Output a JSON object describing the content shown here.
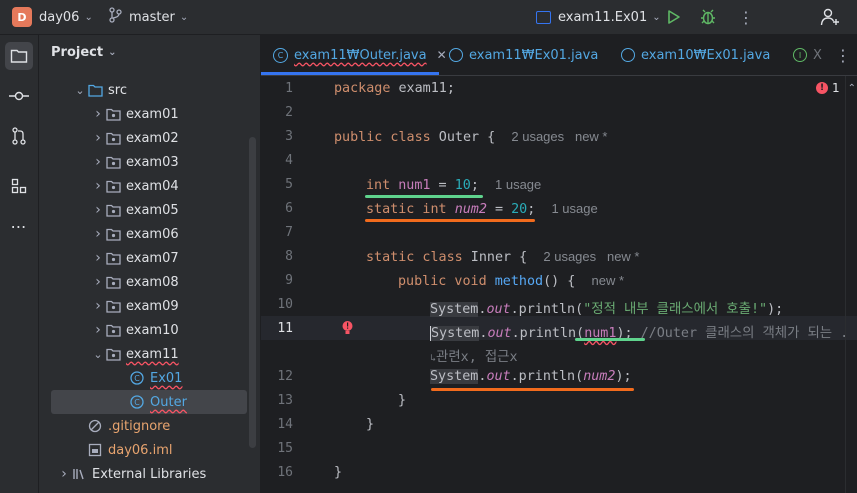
{
  "titlebar": {
    "project_badge": "D",
    "project_name": "day06",
    "branch": "master",
    "run_config": "exam11.Ex01"
  },
  "sidebar_icons": [
    "folder-icon",
    "commit-icon",
    "pull-requests-icon",
    "structure-icon",
    "more-icon"
  ],
  "project_panel": {
    "title": "Project",
    "tree": [
      {
        "label": "src",
        "type": "folder",
        "indent": 1,
        "expanded": true
      },
      {
        "label": "exam01",
        "type": "package",
        "indent": 2
      },
      {
        "label": "exam02",
        "type": "package",
        "indent": 2
      },
      {
        "label": "exam03",
        "type": "package",
        "indent": 2
      },
      {
        "label": "exam04",
        "type": "package",
        "indent": 2
      },
      {
        "label": "exam05",
        "type": "package",
        "indent": 2
      },
      {
        "label": "exam06",
        "type": "package",
        "indent": 2
      },
      {
        "label": "exam07",
        "type": "package",
        "indent": 2
      },
      {
        "label": "exam08",
        "type": "package",
        "indent": 2
      },
      {
        "label": "exam09",
        "type": "package",
        "indent": 2
      },
      {
        "label": "exam10",
        "type": "package",
        "indent": 2
      },
      {
        "label": "exam11",
        "type": "package",
        "indent": 2,
        "expanded": true
      },
      {
        "label": "Ex01",
        "type": "class",
        "indent": 3
      },
      {
        "label": "Outer",
        "type": "class",
        "indent": 3,
        "selected": true
      },
      {
        "label": ".gitignore",
        "type": "ignore",
        "indent": 1
      },
      {
        "label": "day06.iml",
        "type": "iml",
        "indent": 1
      },
      {
        "label": "External Libraries",
        "type": "lib",
        "indent": 0
      }
    ]
  },
  "tabs": [
    {
      "label": "exam11₩Outer.java",
      "active": true
    },
    {
      "label": "exam11₩Ex01.java",
      "active": false
    },
    {
      "label": "exam10₩Ex01.java",
      "active": false
    },
    {
      "label": "X",
      "active": false
    }
  ],
  "editor": {
    "problems_count": "1",
    "line_numbers": [
      "1",
      "2",
      "3",
      "4",
      "5",
      "6",
      "7",
      "8",
      "9",
      "10",
      "11",
      "12",
      "13",
      "14",
      "15",
      "16"
    ],
    "lines": {
      "l1": {
        "kw": "package",
        "rest": " exam11;"
      },
      "l3": {
        "kw": "public class",
        "rest": " Outer {",
        "hint": "2 usages   new *"
      },
      "l5": {
        "kw": "int",
        "fld": "num1",
        "op": " = ",
        "num": "10",
        "end": ";",
        "hint": "1 usage"
      },
      "l6": {
        "kw": "static int",
        "fld": "num2",
        "op": " = ",
        "num": "20",
        "end": ";",
        "hint": "1 usage"
      },
      "l8": {
        "kw": "static class",
        "rest": " Inner {",
        "hint": "2 usages   new *"
      },
      "l9": {
        "kw": "public void",
        "fn": "method",
        "rest": "() {",
        "hint": "new *"
      },
      "l10": {
        "sys": "System",
        "dot": ".",
        "out": "out",
        "call": ".println(",
        "str": "\"정적 내부 클래스에서 호출!\"",
        "end": ");"
      },
      "l11": {
        "sys": "System",
        "dot": ".",
        "out": "out",
        "call": ".println(",
        "fld": "num1",
        "end": ");",
        "cmt": "//Outer 클래스의 객체가 되는 ."
      },
      "l11_wrap": "관련x, 접근x",
      "l12": {
        "sys": "System",
        "dot": ".",
        "out": "out",
        "call": ".println(",
        "fld": "num2",
        "end": ");"
      },
      "l13": "}",
      "l14": "}",
      "l16": "}"
    }
  },
  "colors": {
    "accent": "#3574f0",
    "green_underline": "#5fd38d",
    "orange_underline": "#f26b1d",
    "error": "#f75464"
  }
}
